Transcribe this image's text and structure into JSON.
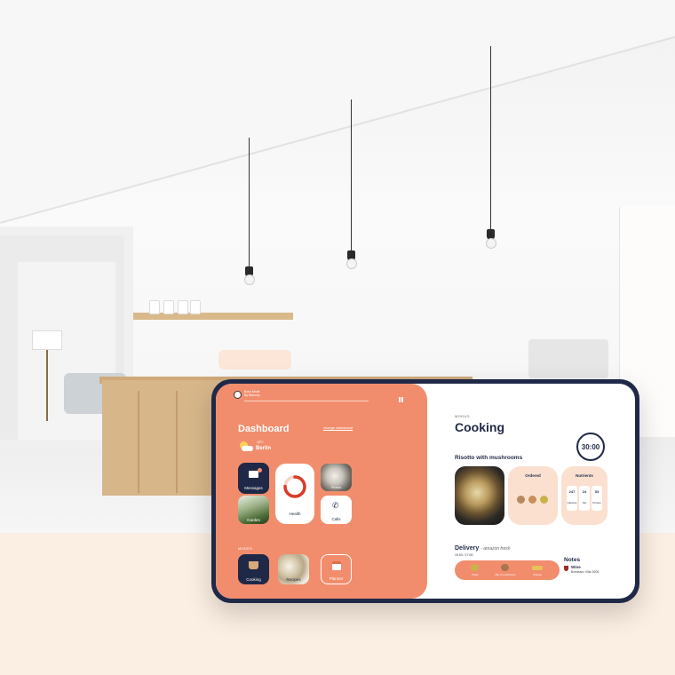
{
  "player": {
    "track": "Boss Mode",
    "artist": "By Balcony"
  },
  "dashboard": {
    "title": "Dashboard",
    "change_link": "change dashboard",
    "weather": {
      "temp": "18°C",
      "city": "Berlin"
    },
    "tiles": {
      "messages": "Messages",
      "garden": "Garden",
      "health": "Health",
      "photo": "Photos",
      "calls": "Calls"
    },
    "health_progress": 0.75,
    "modes_label": "MODES",
    "modes": {
      "cooking": "Cooking",
      "recipes": "Recipes",
      "planner": "Planner"
    }
  },
  "cooking": {
    "mode_label": "MODUS",
    "title": "Cooking",
    "timer": "30:00",
    "recipe": "Risotto with mushrooms",
    "ordered_title": "Ordered",
    "nutrients_title": "Nutrients",
    "nutrients": [
      {
        "value": "247",
        "name": "Calories"
      },
      {
        "value": "24",
        "name": "Fat"
      },
      {
        "value": "53",
        "name": "Protein"
      }
    ],
    "delivery_title": "Delivery",
    "delivery_source": "- amazon fresh",
    "delivery_date": "19.03 / 17:00",
    "delivery_items": [
      "Pears",
      "Mix of mushrooms",
      "Cheese"
    ],
    "notes_title": "Notes",
    "wine_title": "Wine",
    "wine_sub": "Bordeaux Villa 2008"
  },
  "colors": {
    "accent": "#f18d6d",
    "navy": "#1f2947",
    "card": "#fbe0d0",
    "background": "#fbeee2"
  }
}
